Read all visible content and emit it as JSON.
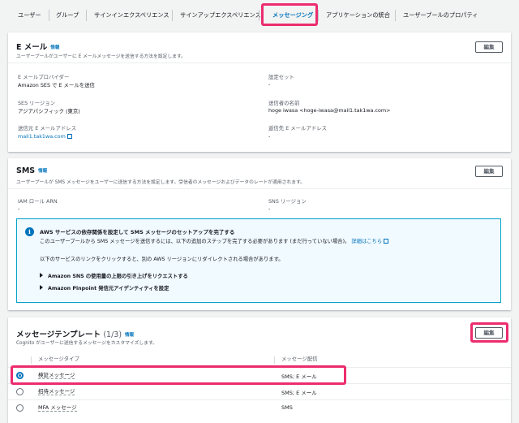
{
  "tabs": [
    {
      "label": "ユーザー"
    },
    {
      "label": "グループ"
    },
    {
      "label": "サインインエクスペリエンス"
    },
    {
      "label": "サインアップエクスペリエンス"
    },
    {
      "label": "メッセージング"
    },
    {
      "label": "アプリケーションの統合"
    },
    {
      "label": "ユーザープールのプロパティ"
    }
  ],
  "email": {
    "title": "E メール",
    "info": "情報",
    "description": "ユーザープールがユーザーに E メールメッセージを送信する方法を設定します。",
    "edit": "編集",
    "fields": {
      "provider_label": "E メールプロバイダー",
      "provider_value": "Amazon SES で E メールを送信",
      "config_set_label": "設定セット",
      "config_set_value": "-",
      "region_label": "SES リージョン",
      "region_value": "アジアパシフィック (東京)",
      "sender_name_label": "送信者の名前",
      "sender_name_value": "hoge iwasa <hoge-iwasa@mail1.tak1wa.com>",
      "from_label": "送信元 E メールアドレス",
      "from_value": "mail1.tak1wa.com",
      "reply_label": "返信先 E メールアドレス",
      "reply_value": "-"
    }
  },
  "sms": {
    "title": "SMS",
    "info": "情報",
    "description": "ユーザープールが SMS メッセージをユーザーに送信する方法を設定します。受信者のメッセージおよびデータのレートが適用されます。",
    "edit": "編集",
    "iam_label": "IAM ロール ARN",
    "iam_value": "-",
    "region_label": "SNS リージョン",
    "region_value": "-",
    "alert": {
      "icon": "i",
      "title": "AWS サービスの依存関係を設定して SMS メッセージのセットアップを完了する",
      "line1": "このユーザープールから SMS メッセージを送信するには、以下の追加のステップを完了する必要があります (まだ行っていない場合)。",
      "link": "詳細はこちら",
      "line2": "以下のサービスのリンクをクリックすると、別の AWS リージョンにリダイレクトされる場合があります。",
      "step1": "Amazon SNS の使用量の上限の引き上げをリクエストする",
      "step2": "Amazon Pinpoint 発信元アイデンティティを設定"
    }
  },
  "templates": {
    "title": "メッセージテンプレート",
    "count": "(1/3)",
    "info": "情報",
    "description": "Cognito がユーザーに送信するメッセージをカスタマイズします。",
    "edit": "編集",
    "col_type": "メッセージタイプ",
    "col_delivery": "メッセージ配信",
    "rows": [
      {
        "name": "検証メッセージ",
        "delivery": "SMS; E メール",
        "selected": true
      },
      {
        "name": "招待メッセージ",
        "delivery": "SMS; E メール",
        "selected": false
      },
      {
        "name": "MFA メッセージ",
        "delivery": "SMS",
        "selected": false
      }
    ]
  },
  "colors": {
    "accent": "#0073bb",
    "highlight": "#ec2c6e",
    "background": "#f2f3f3"
  }
}
